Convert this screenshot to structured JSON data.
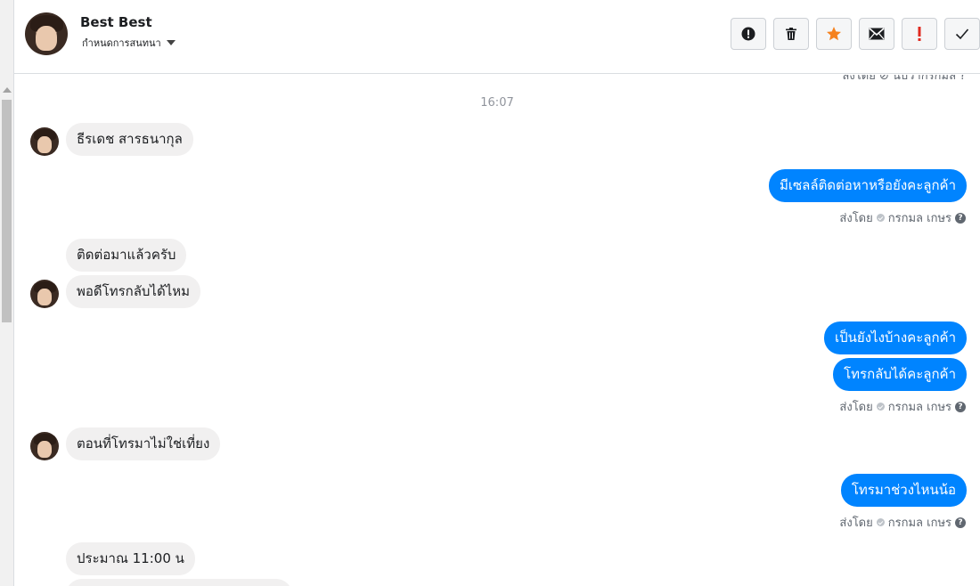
{
  "header": {
    "name": "Best Best",
    "subtitle": "กำหนดการสนทนา",
    "toolbar": [
      {
        "icon": "alert-circle-icon",
        "label": ""
      },
      {
        "icon": "trash-icon",
        "label": ""
      },
      {
        "icon": "star-icon",
        "label": ""
      },
      {
        "icon": "envelope-icon",
        "label": ""
      },
      {
        "icon": "exclamation-icon",
        "label": ""
      },
      {
        "icon": "check-icon",
        "label": ""
      }
    ]
  },
  "colors": {
    "outgoing": "#0084ff",
    "incoming": "#f1f0f0",
    "star": "#f5821f",
    "exclamation": "#e02a20"
  },
  "thread": {
    "top_sent_by": "ส่งโดย ⊘ นับว่ากรกมล ?",
    "time_separator": "16:07",
    "messages": [
      {
        "side": "in",
        "text": "ธีรเดช  สารธนากุล"
      },
      {
        "side": "out",
        "text": "มีเซลล์ติดต่อหาหรือยังคะลูกค้า"
      },
      {
        "side": "in",
        "text": "ติดต่อมาแล้วครับ"
      },
      {
        "side": "in",
        "text": "พอดีโทรกลับได้ไหม"
      },
      {
        "side": "out",
        "text": "เป็นยังไงบ้างคะลูกค้า"
      },
      {
        "side": "out",
        "text": "โทรกลับได้คะลูกค้า"
      },
      {
        "side": "in",
        "text": "ตอนที่โทรมาไม่ใช่เที่ยง"
      },
      {
        "side": "out",
        "text": "โทรมาช่วงไหนน้อ"
      },
      {
        "side": "in",
        "text": "ประมาณ 11:00 น"
      }
    ],
    "sent_by_label": "ส่งโดย",
    "sent_by_name": "กรกมล เกษร"
  }
}
